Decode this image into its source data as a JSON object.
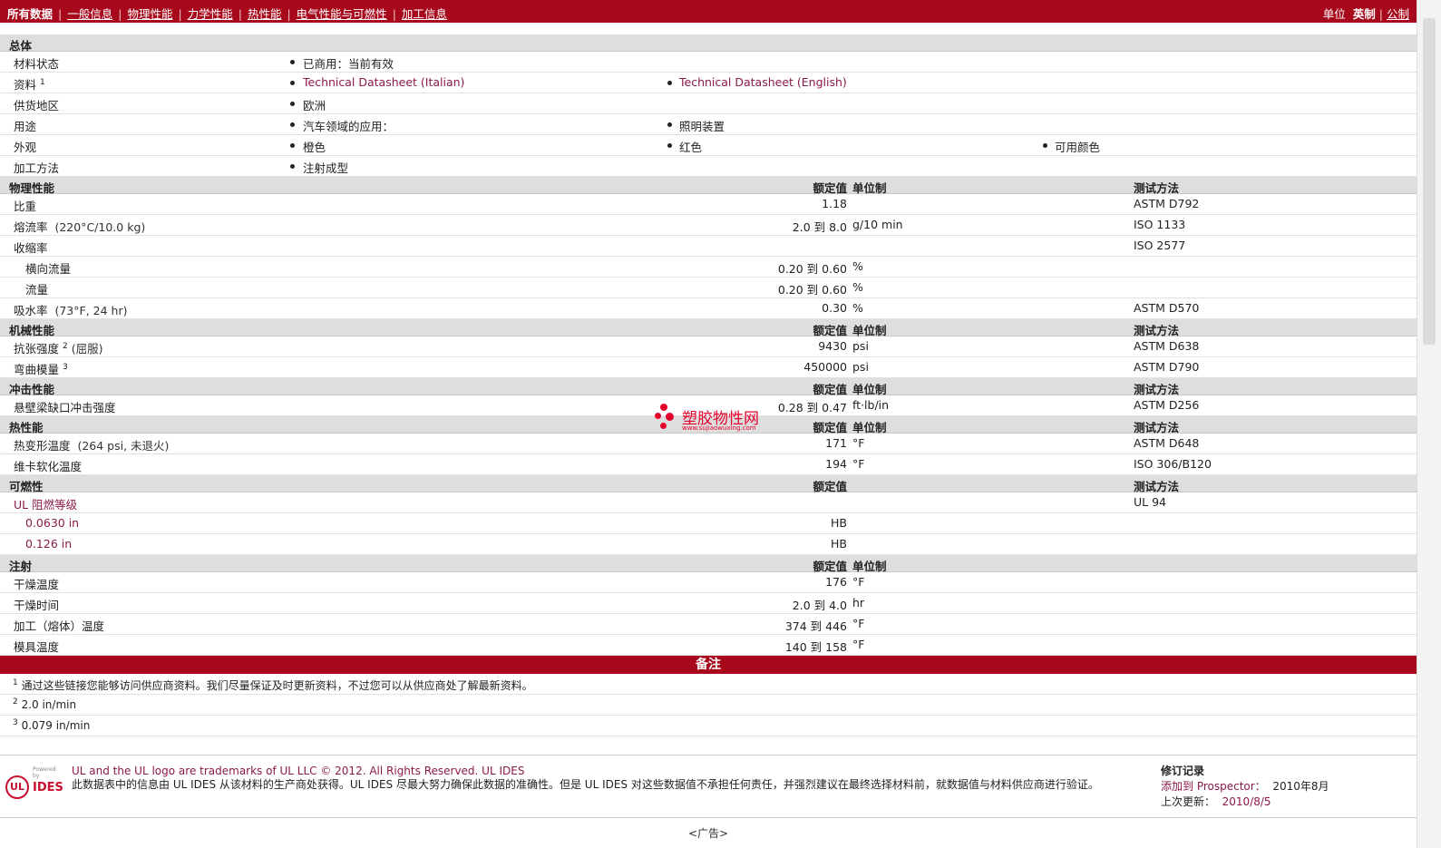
{
  "nav": {
    "items": [
      "所有数据",
      "一般信息",
      "物理性能",
      "力学性能",
      "热性能",
      "电气性能与可燃性",
      "加工信息"
    ],
    "units_label": "单位",
    "unit_imperial": "英制",
    "unit_metric": "公制"
  },
  "general": {
    "section": "总体",
    "status_label": "材料状态",
    "status_value": "已商用：当前有效",
    "docs_label": "资料",
    "docs_sup": "1",
    "doc1": "Technical Datasheet (Italian)",
    "doc2": "Technical Datasheet (English)",
    "region_label": "供货地区",
    "region_value": "欧洲",
    "use_label": "用途",
    "use1": "汽车领域的应用：",
    "use2": "照明装置",
    "appearance_label": "外观",
    "app1": "橙色",
    "app2": "红色",
    "app3": "可用颜色",
    "process_label": "加工方法",
    "process_value": "注射成型"
  },
  "headers": {
    "nominal": "额定值",
    "unit": "单位制",
    "test": "测试方法"
  },
  "physical": {
    "section": "物理性能",
    "rows": [
      {
        "name": "比重",
        "cond": "",
        "val": "1.18",
        "unit": "",
        "test": "ASTM D792"
      },
      {
        "name": "熔流率",
        "cond": "(220°C/10.0 kg)",
        "val": "2.0 到  8.0",
        "unit": "g/10 min",
        "test": "ISO 1133"
      },
      {
        "name": "收缩率",
        "cond": "",
        "val": "",
        "unit": "",
        "test": "ISO 2577"
      },
      {
        "name": "横向流量",
        "cond": "",
        "val": "0.20 到  0.60",
        "unit": "%",
        "test": "",
        "sub": true
      },
      {
        "name": "流量",
        "cond": "",
        "val": "0.20 到  0.60",
        "unit": "%",
        "test": "",
        "sub": true
      },
      {
        "name": "吸水率",
        "cond": "(73°F, 24 hr)",
        "val": "0.30",
        "unit": "%",
        "test": "ASTM D570"
      }
    ]
  },
  "mechanical": {
    "section": "机械性能",
    "rows": [
      {
        "name": "抗张强度",
        "sup": "2",
        "cond": "(屈服)",
        "val": "9430",
        "unit": "psi",
        "test": "ASTM D638"
      },
      {
        "name": "弯曲模量",
        "sup": "3",
        "cond": "",
        "val": "450000",
        "unit": "psi",
        "test": "ASTM D790"
      }
    ]
  },
  "impact": {
    "section": "冲击性能",
    "rows": [
      {
        "name": "悬壁梁缺口冲击强度",
        "cond": "",
        "val": "0.28 到  0.47",
        "unit": "ft·lb/in",
        "test": "ASTM D256"
      }
    ]
  },
  "thermal": {
    "section": "热性能",
    "rows": [
      {
        "name": "热变形温度",
        "cond": "(264 psi, 未退火)",
        "val": "171",
        "unit": "°F",
        "test": "ASTM D648"
      },
      {
        "name": "维卡软化温度",
        "cond": "",
        "val": "194",
        "unit": "°F",
        "test": "ISO 306/B120"
      }
    ]
  },
  "flammability": {
    "section": "可燃性",
    "rating_label": "UL 阻燃等级",
    "rating_test": "UL 94",
    "thick1": "0.0630 in",
    "thick1_val": "HB",
    "thick2": "0.126 in",
    "thick2_val": "HB"
  },
  "injection": {
    "section": "注射",
    "rows": [
      {
        "name": "干燥温度",
        "val": "176",
        "unit": "°F"
      },
      {
        "name": "干燥时间",
        "val": "2.0 到  4.0",
        "unit": "hr"
      },
      {
        "name": "加工（熔体）温度",
        "val": "374 到  446",
        "unit": "°F"
      },
      {
        "name": "模具温度",
        "val": "140 到  158",
        "unit": "°F"
      }
    ]
  },
  "notes": {
    "title": "备注",
    "n1_sup": "1",
    "n1": "通过这些链接您能够访问供应商资料。我们尽量保证及时更新资料，不过您可以从供应商处了解最新资料。",
    "n2_sup": "2",
    "n2": "2.0 in/min",
    "n3_sup": "3",
    "n3": "0.079 in/min"
  },
  "footer": {
    "powered_by": "Powered by",
    "logo_ul": "UL",
    "logo_ides": "IDES",
    "line1": "UL and the UL logo are trademarks of UL LLC © 2012. All Rights Reserved. UL IDES",
    "line2": "此数据表中的信息由  UL IDES 从该材料的生产商处获得。UL IDES 尽最大努力确保此数据的准确性。但是  UL IDES 对这些数据值不承担任何责任，并强烈建议在最终选择材料前，就数据值与材料供应商进行验证。",
    "rev_title": "修订记录",
    "rev_added_label": "添加到  Prospector：",
    "rev_added": "2010年8月",
    "rev_updated_label": "上次更新：",
    "rev_updated": "2010/8/5",
    "ad": "<广告>"
  },
  "watermark": {
    "title": "塑胶物性网",
    "url": "www.sujiaowuxing.com"
  },
  "colors": {
    "brand": "#a8081c",
    "link": "#8b1a4b"
  }
}
